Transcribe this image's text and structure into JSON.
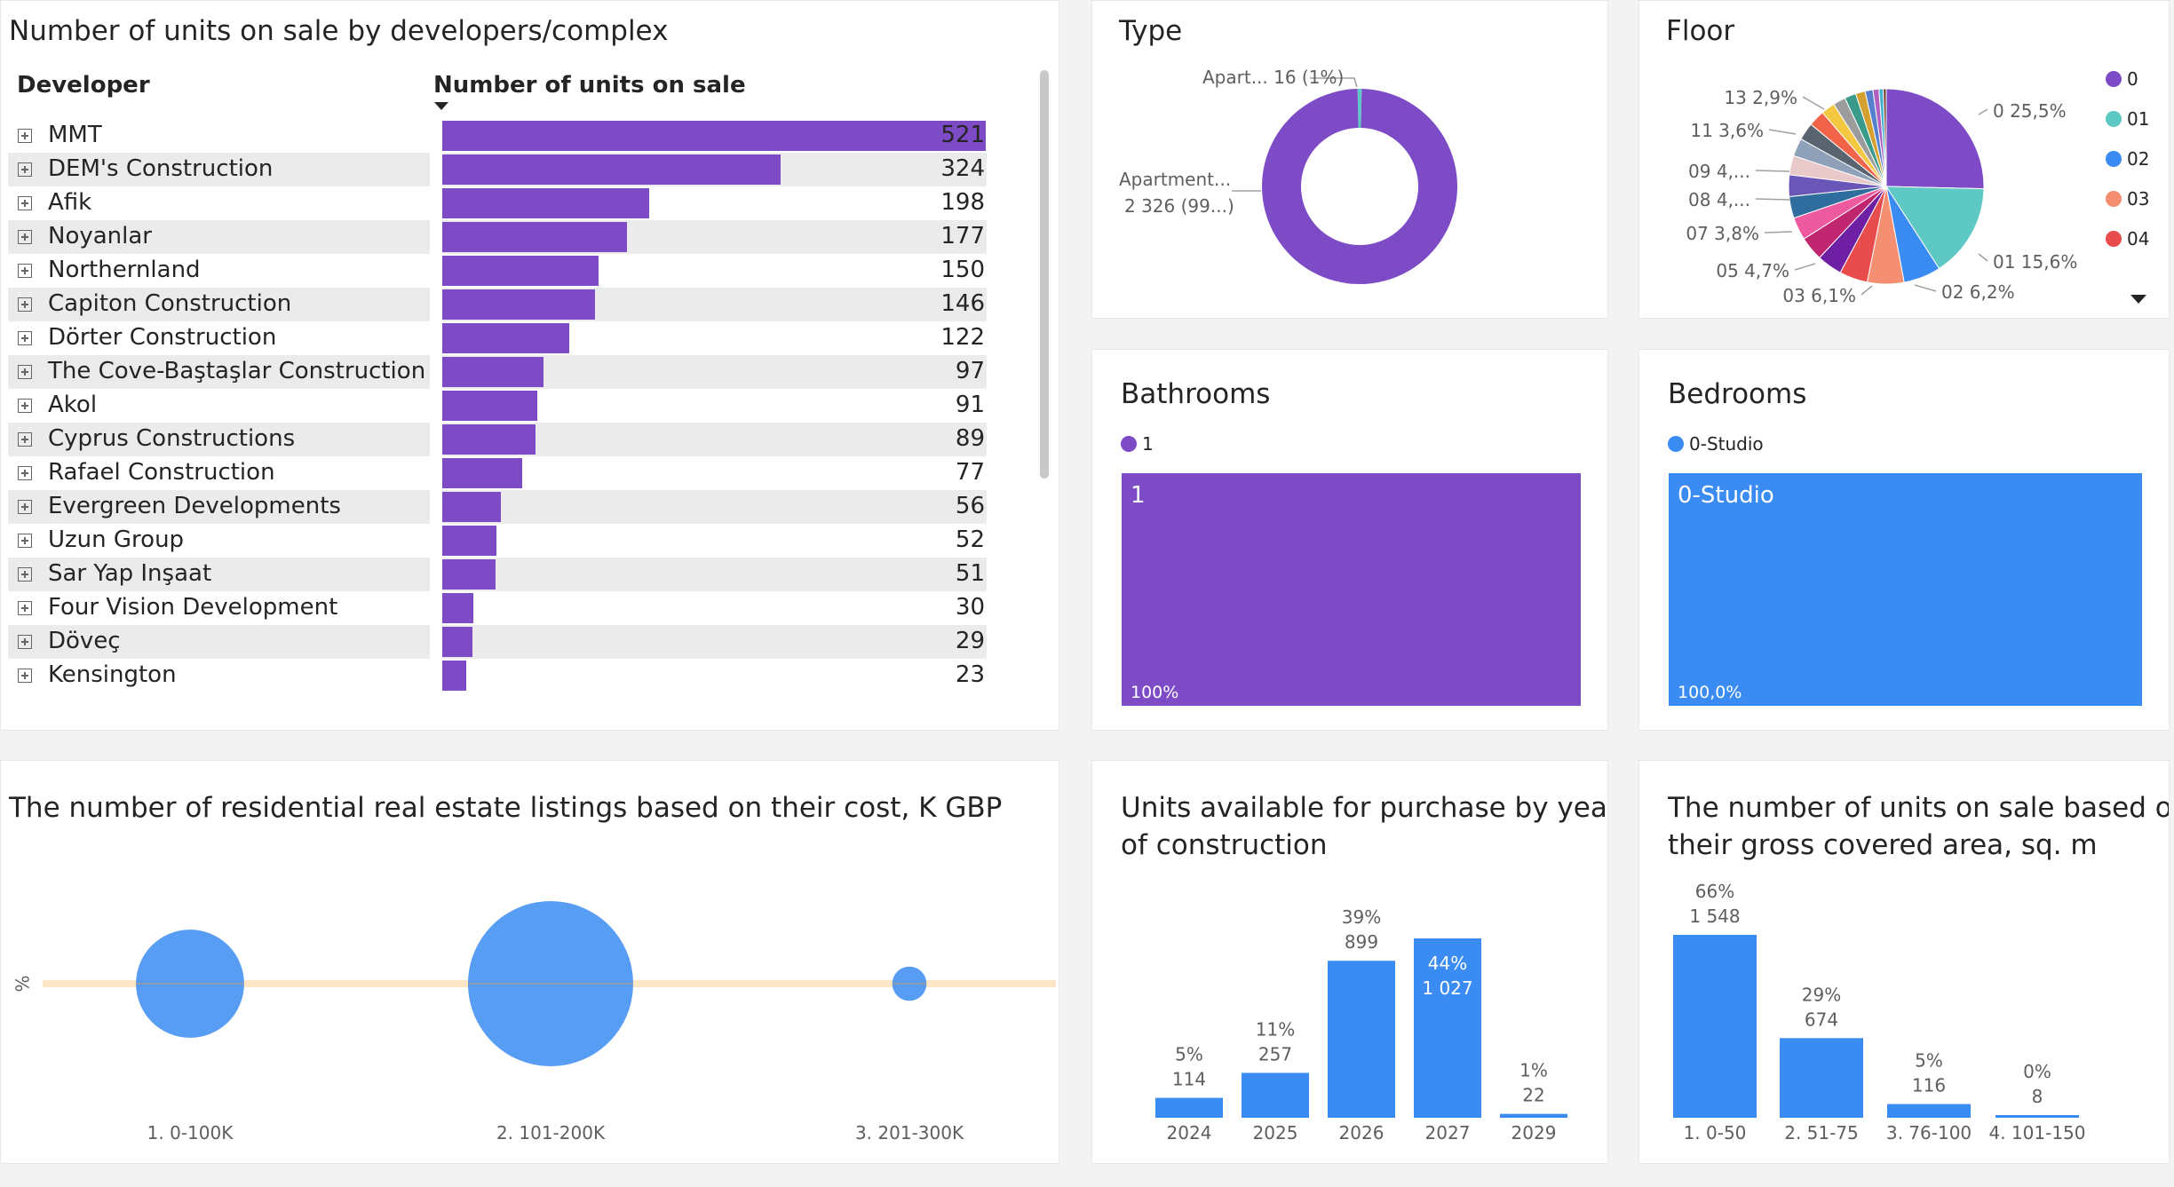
{
  "developers": {
    "title": "Number of units on sale by developers/complex",
    "col_developer": "Developer",
    "col_units": "Number of units on sale",
    "sort_icon": "sort-descending-icon",
    "expand_icon": "expand-plus-icon",
    "bar_color": "#7e4bc6",
    "max": 521,
    "rows": [
      {
        "name": "MMT",
        "value": 521
      },
      {
        "name": "DEM's Construction",
        "value": 324
      },
      {
        "name": "Afik",
        "value": 198
      },
      {
        "name": "Noyanlar",
        "value": 177
      },
      {
        "name": "Northernland",
        "value": 150
      },
      {
        "name": "Capiton Construction",
        "value": 146
      },
      {
        "name": "Dörter Construction",
        "value": 122
      },
      {
        "name": "The Cove-Baştaşlar Construction",
        "value": 97
      },
      {
        "name": "Akol",
        "value": 91
      },
      {
        "name": "Cyprus Constructions",
        "value": 89
      },
      {
        "name": "Rafael Construction",
        "value": 77
      },
      {
        "name": "Evergreen Developments",
        "value": 56
      },
      {
        "name": "Uzun Group",
        "value": 52
      },
      {
        "name": "Sar Yap Inşaat",
        "value": 51
      },
      {
        "name": "Four Vision Development",
        "value": 30
      },
      {
        "name": "Döveç",
        "value": 29
      },
      {
        "name": "Kensington",
        "value": 23
      }
    ]
  },
  "type": {
    "title": "Type",
    "label_small": "Apart... 16 (1%)",
    "label_big_1": "Apartment...",
    "label_big_2": "2 326 (99...)"
  },
  "floor": {
    "title": "Floor",
    "legend": [
      {
        "label": "0",
        "color": "#7e4bc6"
      },
      {
        "label": "01",
        "color": "#5ec8c4"
      },
      {
        "label": "02",
        "color": "#3b8cf2"
      },
      {
        "label": "03",
        "color": "#f58f72"
      },
      {
        "label": "04",
        "color": "#e84c4c"
      }
    ],
    "legend_more_icon": "caret-down-icon",
    "labels": [
      "0 25,5%",
      "01 15,6%",
      "02 6,2%",
      "03 6,1%",
      "05 4,7%",
      "07 3,8%",
      "08 4,...",
      "09 4,...",
      "11 3,6%",
      "13 2,9%"
    ]
  },
  "bathrooms": {
    "title": "Bathrooms",
    "legend_label": "1",
    "tile_label": "1",
    "pct": "100%",
    "color": "#7e4bc6"
  },
  "bedrooms": {
    "title": "Bedrooms",
    "legend_label": "0-Studio",
    "tile_label": "0-Studio",
    "pct": "100,0%",
    "color": "#3b8cf2"
  },
  "cost": {
    "title": "The number of residential real estate listings based on their cost, K GBP",
    "y_label": "%",
    "categories": [
      "1. 0-100K",
      "2. 101-200K",
      "3. 201-300K"
    ]
  },
  "year": {
    "title_1": "Units available for purchase by year",
    "title_2": "of construction"
  },
  "area": {
    "title_1": "The number of units on sale based on",
    "title_2": "their gross covered area, sq. m"
  },
  "chart_data": [
    {
      "type": "bar",
      "title": "Number of units on sale by developers/complex",
      "categories": [
        "MMT",
        "DEM's Construction",
        "Afik",
        "Noyanlar",
        "Northernland",
        "Capiton Construction",
        "Dörter Construction",
        "The Cove-Baştaşlar Construction",
        "Akol",
        "Cyprus Constructions",
        "Rafael Construction",
        "Evergreen Developments",
        "Uzun Group",
        "Sar Yap Inşaat",
        "Four Vision Development",
        "Döveç",
        "Kensington"
      ],
      "values": [
        521,
        324,
        198,
        177,
        150,
        146,
        122,
        97,
        91,
        89,
        77,
        56,
        52,
        51,
        30,
        29,
        23
      ]
    },
    {
      "type": "pie",
      "title": "Type",
      "values": [
        2326,
        16
      ],
      "colors": [
        "#7e4bc6",
        "#5ec8c4"
      ]
    },
    {
      "type": "pie",
      "title": "Floor",
      "values": [
        25.5,
        15.6,
        6.2,
        6.1,
        4.7,
        4.2,
        4.0,
        3.8,
        3.6,
        3.6,
        3.2,
        3.0,
        2.9,
        2.7,
        2.3,
        2.1,
        1.9,
        1.6,
        1.3,
        1.0,
        0.7,
        0.5
      ],
      "colors": [
        "#7e4bc6",
        "#5ec8c4",
        "#3b8cf2",
        "#f58f72",
        "#e84c4c",
        "#6f1fa3",
        "#c0266f",
        "#ee5aa0",
        "#2e6d9e",
        "#6a55b8",
        "#e8c8c8",
        "#8fa1b8",
        "#5a6470",
        "#f2644a",
        "#f5c842",
        "#9c9c9c",
        "#3a9b8a",
        "#d4a030",
        "#5580d0",
        "#b060c0",
        "#40b0d0",
        "#704030"
      ]
    },
    {
      "type": "bar",
      "title": "Bathrooms",
      "categories": [
        "1"
      ],
      "values": [
        100
      ]
    },
    {
      "type": "bar",
      "title": "Bedrooms",
      "categories": [
        "0-Studio"
      ],
      "values": [
        100.0
      ]
    },
    {
      "type": "scatter",
      "title": "The number of residential real estate listings based on their cost, K GBP",
      "categories": [
        "1. 0-100K",
        "2. 101-200K",
        "3. 201-300K"
      ],
      "values": [
        0.6,
        1.4,
        0.06
      ],
      "ylabel": "%"
    },
    {
      "type": "bar",
      "title": "Units available for purchase by year of construction",
      "categories": [
        "2024",
        "2025",
        "2026",
        "2027",
        "2029"
      ],
      "values": [
        114,
        257,
        899,
        1027,
        22
      ],
      "value_labels": [
        "114",
        "257",
        "899",
        "1 027",
        "22"
      ],
      "pct_labels": [
        "5%",
        "11%",
        "39%",
        "44%",
        "1%"
      ]
    },
    {
      "type": "bar",
      "title": "The number of units on sale based on their gross covered area, sq. m",
      "categories": [
        "1. 0-50",
        "2. 51-75",
        "3. 76-100",
        "4. 101-150"
      ],
      "values": [
        1548,
        674,
        116,
        8
      ],
      "value_labels": [
        "1 548",
        "674",
        "116",
        "8"
      ],
      "pct_labels": [
        "66%",
        "29%",
        "5%",
        "0%"
      ]
    }
  ]
}
